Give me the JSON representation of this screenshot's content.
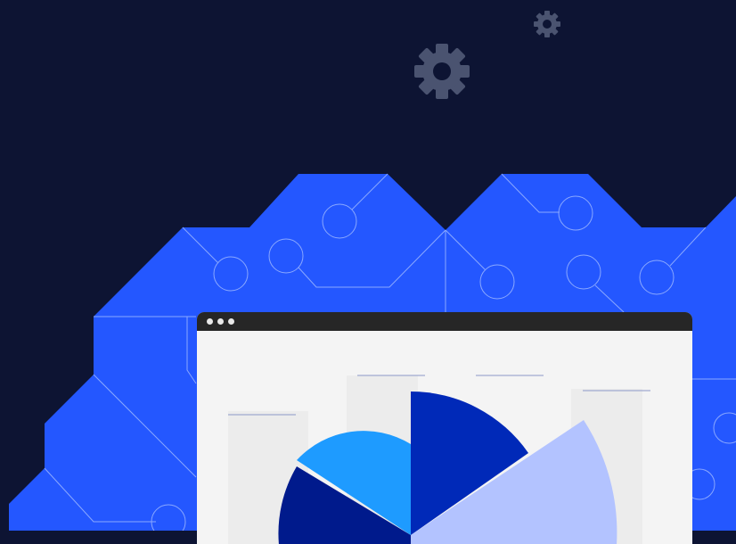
{
  "colors": {
    "background": "#0d1433",
    "brain": "#2457ff",
    "brain_line": "#8aa8ff",
    "gear": "#4a5370",
    "window_bar": "#262626",
    "window_body": "#f4f4f4"
  },
  "icons": {
    "large_gear": "gear-icon",
    "small_gear": "gear-icon"
  },
  "window": {
    "controls": [
      "dot",
      "dot",
      "dot"
    ]
  },
  "pie": {
    "slices": [
      {
        "color": "#1e9bff"
      },
      {
        "color": "#0029b8"
      },
      {
        "color": "#b3c3ff"
      },
      {
        "color": "#001a8c"
      }
    ]
  }
}
